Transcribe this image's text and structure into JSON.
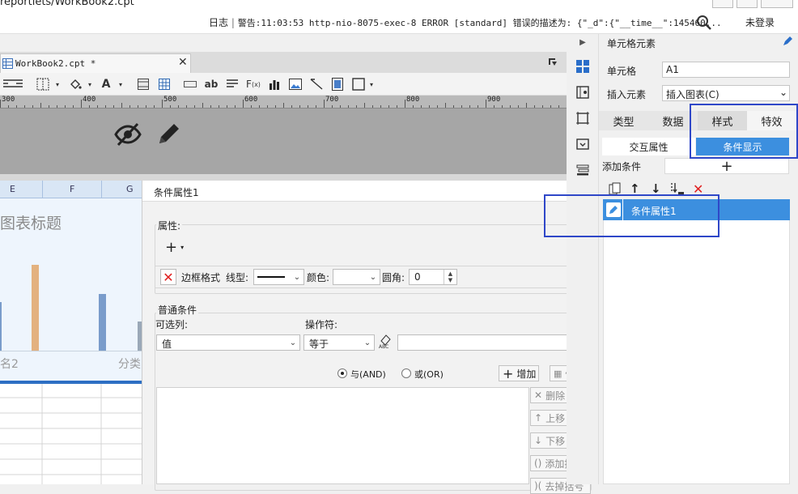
{
  "window": {
    "title": "reportlets/WorkBook2.cpt"
  },
  "status": {
    "log_label": "日志",
    "log_message": "警告:11:03:53 http-nio-8075-exec-8 ERROR [standard] 错误的描述为: {\"_d\":{\"__time__\":145460...",
    "login": "未登录"
  },
  "editor": {
    "tab_label": "WorkBook2.cpt *",
    "ruler": [
      "300",
      "400",
      "500",
      "600",
      "700",
      "800",
      "900"
    ],
    "columns": [
      "E",
      "F",
      "G"
    ],
    "chart_title": "图表标题",
    "x_labels": [
      "名2",
      "分类"
    ],
    "bar_colors": [
      "#e3b27f",
      "#7a9ccb",
      "#9aa8b8"
    ]
  },
  "dialog": {
    "title": "条件属性1",
    "attr_section": "属性:",
    "add_symbol": "+",
    "border_format": "边框格式",
    "line_type_label": "线型:",
    "color_label": "颜色:",
    "radius_label": "圆角:",
    "radius_value": "0",
    "normal_condition": "普通条件",
    "optional_col": "可选列:",
    "operator": "操作符:",
    "col_value": "值",
    "op_value": "等于",
    "and_label": "与(AND)",
    "or_label": "或(OR)",
    "add_button": "增加",
    "modify_button": "修改",
    "delete_button": "删除",
    "up_button": "上移",
    "down_button": "下移",
    "bracket_button": "添加括号",
    "remove_bracket_button": "去掉括号"
  },
  "panel": {
    "heading": "单元格元素",
    "cell_label": "单元格",
    "cell_value": "A1",
    "insert_label": "插入元素",
    "insert_value": "插入图表(C)",
    "tabs": [
      "类型",
      "数据",
      "样式",
      "特效"
    ],
    "subtab_interaction": "交互属性",
    "subtab_condition": "条件显示",
    "add_condition": "添加条件",
    "add_condition_plus": "+",
    "list_item": "条件属性1"
  },
  "colors": {
    "accent": "#3c8fdf",
    "highlight": "#2f47c8",
    "danger": "#e02020"
  }
}
